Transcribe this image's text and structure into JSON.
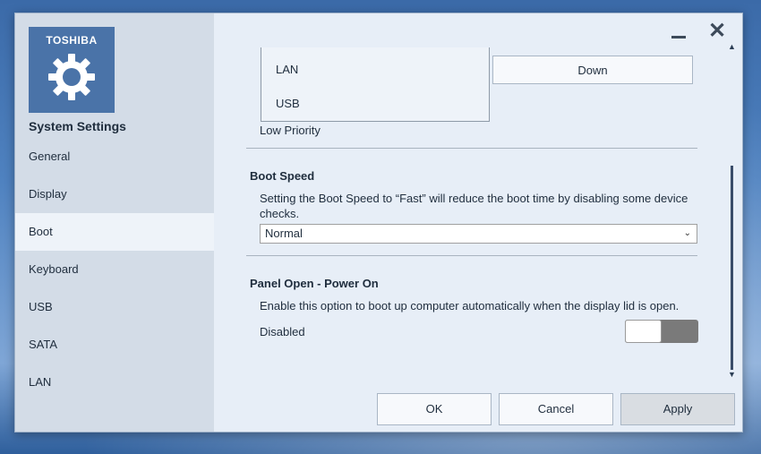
{
  "sidebar": {
    "logo_text": "TOSHIBA",
    "app_title": "System Settings",
    "items": [
      {
        "label": "General"
      },
      {
        "label": "Display"
      },
      {
        "label": "Boot"
      },
      {
        "label": "Keyboard"
      },
      {
        "label": "USB"
      },
      {
        "label": "SATA"
      },
      {
        "label": "LAN"
      }
    ],
    "active_item": "Boot"
  },
  "window_controls": {
    "minimize_icon": "minimize-icon",
    "close_icon": "close-icon",
    "close_glyph": "✕"
  },
  "boot_priority": {
    "list_items": [
      "LAN",
      "USB"
    ],
    "down_button": "Down",
    "low_priority_label": "Low Priority"
  },
  "boot_speed": {
    "title": "Boot Speed",
    "description": "Setting the Boot Speed to “Fast” will reduce the boot time by disabling some device checks.",
    "selected": "Normal"
  },
  "panel_open": {
    "title": "Panel Open - Power On",
    "description": "Enable this option to boot up computer automatically when the display lid is open.",
    "state_label": "Disabled",
    "enabled": false
  },
  "footer": {
    "ok": "OK",
    "cancel": "Cancel",
    "apply": "Apply"
  },
  "colors": {
    "accent": "#4a73a8",
    "sidebar_bg": "#d3dce7",
    "content_bg": "#e7eef7"
  }
}
